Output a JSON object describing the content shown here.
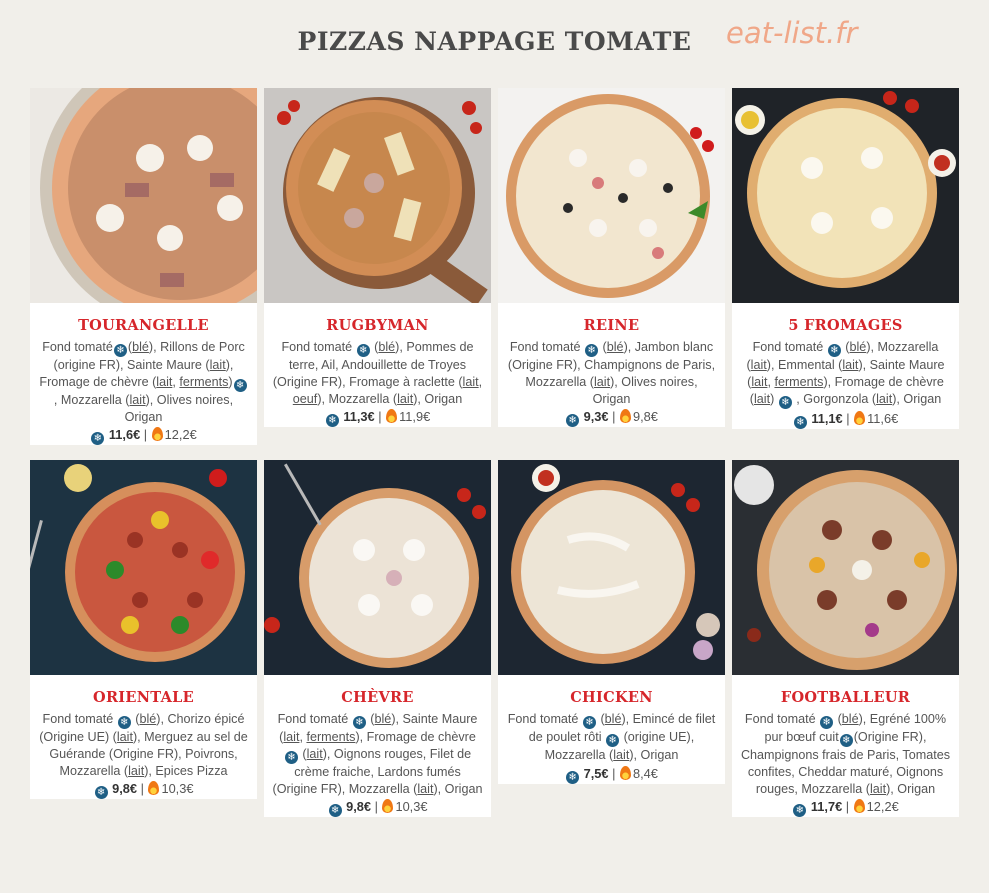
{
  "header": {
    "title": "PIZZAS NAPPAGE TOMATE",
    "watermark": "eat-list.fr"
  },
  "pizzas": [
    {
      "name": "TOURANGELLE",
      "price_frozen": "11,6€",
      "price_hot": "12,2€"
    },
    {
      "name": "RUGBYMAN",
      "price_frozen": "11,3€",
      "price_hot": "11,9€"
    },
    {
      "name": "REINE",
      "price_frozen": "9,3€",
      "price_hot": "9,8€"
    },
    {
      "name": "5 FROMAGES",
      "price_frozen": "11,1€",
      "price_hot": "11,6€"
    },
    {
      "name": "ORIENTALE",
      "price_frozen": "9,8€",
      "price_hot": "10,3€"
    },
    {
      "name": "CHÈVRE",
      "price_frozen": "9,8€",
      "price_hot": "10,3€"
    },
    {
      "name": "CHICKEN",
      "price_frozen": "7,5€",
      "price_hot": "8,4€"
    },
    {
      "name": "FOOTBALLEUR",
      "price_frozen": "11,7€",
      "price_hot": "12,2€"
    }
  ],
  "desc": {
    "tourangelle": [
      "Fond tomaté",
      "(",
      "blé",
      "), Rillons de Porc (origine FR), Sainte Maure (",
      "lait",
      "), Fromage de chèvre (",
      "lait",
      ", ",
      "ferments",
      ")",
      ", Mozzarella (",
      "lait",
      "), Olives noires, Origan"
    ],
    "rugbyman": [
      "Fond tomaté",
      "(",
      "blé",
      "), Pommes de terre, Ail, Andouillette de Troyes (Origine FR), Fromage à raclette (",
      "lait",
      ", ",
      "oeuf",
      "), Mozzarella (",
      "lait",
      "), Origan"
    ],
    "reine": [
      "Fond tomaté",
      "(",
      "blé",
      "), Jambon blanc (Origine FR), Champignons de Paris, Mozzarella (",
      "lait",
      "), Olives noires, Origan"
    ],
    "fromages": [
      "Fond tomaté",
      "(",
      "blé",
      "), Mozzarella (",
      "lait",
      "), Emmental (",
      "lait",
      "), Sainte Maure (",
      "lait",
      ", ",
      "ferments",
      "), Fromage de chèvre (",
      "lait",
      ")",
      ", Gorgonzola (",
      "lait",
      "), Origan"
    ],
    "orientale": [
      "Fond tomaté",
      "(",
      "blé",
      "), Chorizo épicé (Origine UE) (",
      "lait",
      "), Merguez au sel de Guérande (Origine FR), Poivrons, Mozzarella (",
      "lait",
      "), Epices Pizza"
    ],
    "chevre": [
      "Fond tomaté",
      "(",
      "blé",
      "), Sainte Maure (",
      "lait",
      ", ",
      "ferments",
      "), Fromage de chèvre",
      "(",
      "lait",
      "), Oignons rouges, Filet de crème fraiche, Lardons fumés (Origine FR), Mozzarella (",
      "lait",
      "), Origan"
    ],
    "chicken": [
      "Fond tomaté",
      "(",
      "blé",
      "), Emincé de filet de poulet rôti",
      "(origine UE), Mozzarella (",
      "lait",
      "), Origan"
    ],
    "footballeur": [
      "Fond tomaté",
      "(",
      "blé",
      "), Egréné 100% pur bœuf cuit",
      "(Origine FR), Champignons frais de Paris, Tomates confites, Cheddar maturé, Oignons rouges, Mozzarella (",
      "lait",
      "), Origan"
    ]
  },
  "icons": {
    "frozen": "snowflake-icon",
    "hot": "flame-icon",
    "separator": "|"
  },
  "colors": {
    "name_red": "#d6262b",
    "frozen_blue": "#1f5f85",
    "flame_orange": "#f07814",
    "watermark": "#f0a788",
    "background": "#f1efea"
  }
}
